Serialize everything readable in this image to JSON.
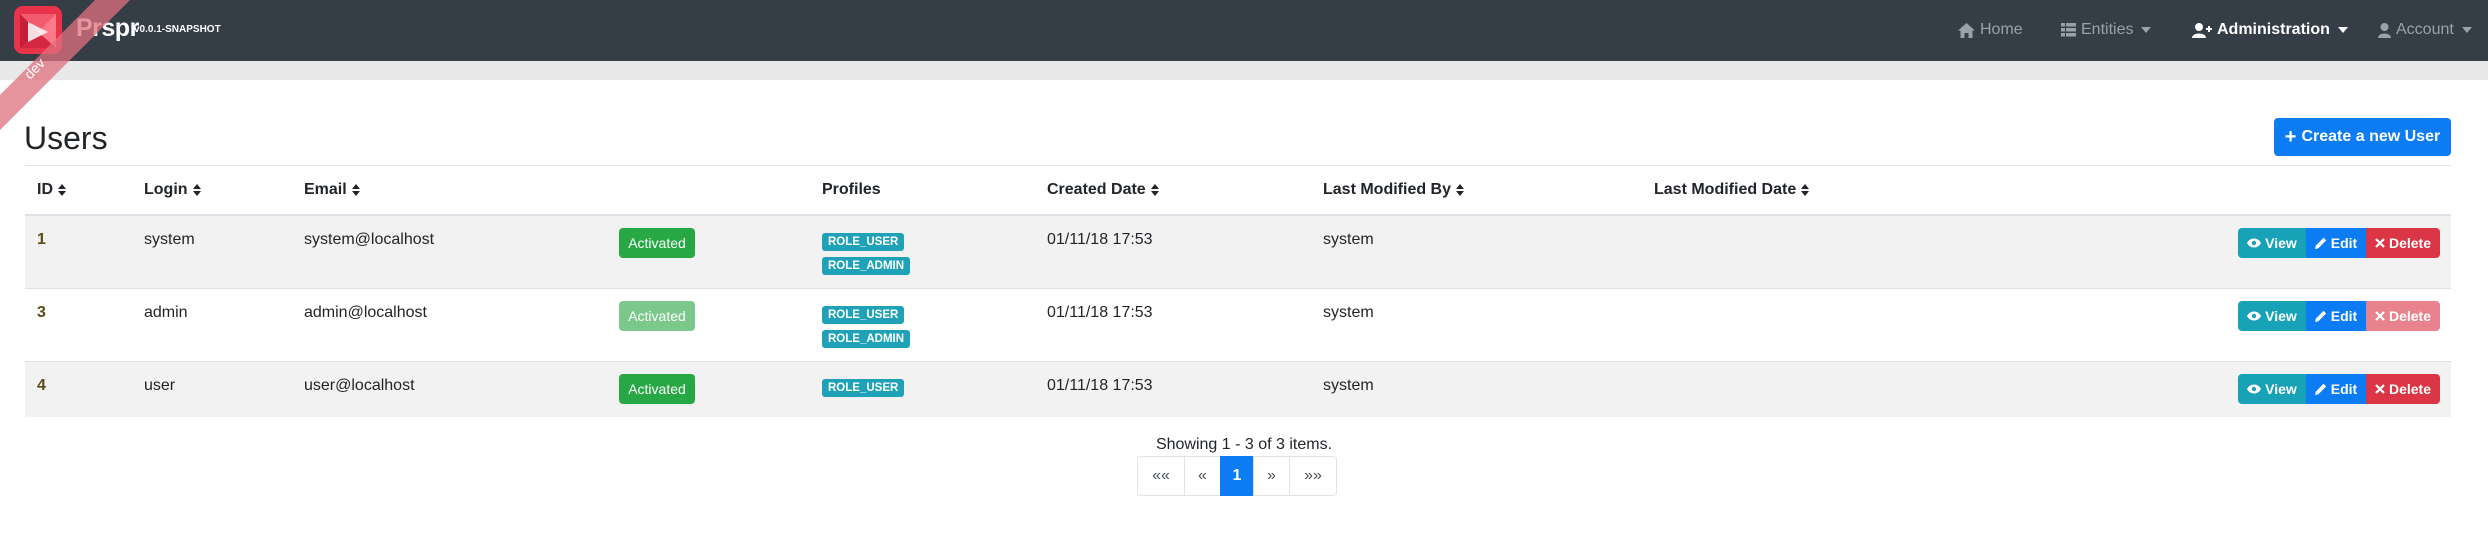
{
  "brand": {
    "name": "Prspr",
    "version": "v0.0.1-SNAPSHOT",
    "ribbon": "dev"
  },
  "nav": {
    "home": "Home",
    "entities": "Entities",
    "administration": "Administration",
    "account": "Account"
  },
  "page": {
    "title": "Users",
    "create_label": "Create a new User"
  },
  "table": {
    "headers": {
      "id": "ID",
      "login": "Login",
      "email": "Email",
      "profiles": "Profiles",
      "created_date": "Created Date",
      "last_modified_by": "Last Modified By",
      "last_modified_date": "Last Modified Date"
    },
    "rows": [
      {
        "id": "1",
        "login": "system",
        "email": "system@localhost",
        "status": "Activated",
        "roles": [
          "ROLE_USER",
          "ROLE_ADMIN"
        ],
        "created_date": "01/11/18 17:53",
        "last_modified_by": "system",
        "last_modified_date": ""
      },
      {
        "id": "3",
        "login": "admin",
        "email": "admin@localhost",
        "status": "Activated",
        "roles": [
          "ROLE_USER",
          "ROLE_ADMIN"
        ],
        "created_date": "01/11/18 17:53",
        "last_modified_by": "system",
        "last_modified_date": ""
      },
      {
        "id": "4",
        "login": "user",
        "email": "user@localhost",
        "status": "Activated",
        "roles": [
          "ROLE_USER"
        ],
        "created_date": "01/11/18 17:53",
        "last_modified_by": "system",
        "last_modified_date": ""
      }
    ],
    "actions": {
      "view": "View",
      "edit": "Edit",
      "delete": "Delete"
    }
  },
  "pagination": {
    "summary": "Showing 1 - 3 of 3 items.",
    "first": "««",
    "prev": "«",
    "current": "1",
    "next": "»",
    "last": "»»"
  },
  "colors": {
    "navbar": "#353d47",
    "primary": "#0c7cf5",
    "success": "#28a745",
    "info": "#17a2b8",
    "danger": "#dc3545"
  }
}
